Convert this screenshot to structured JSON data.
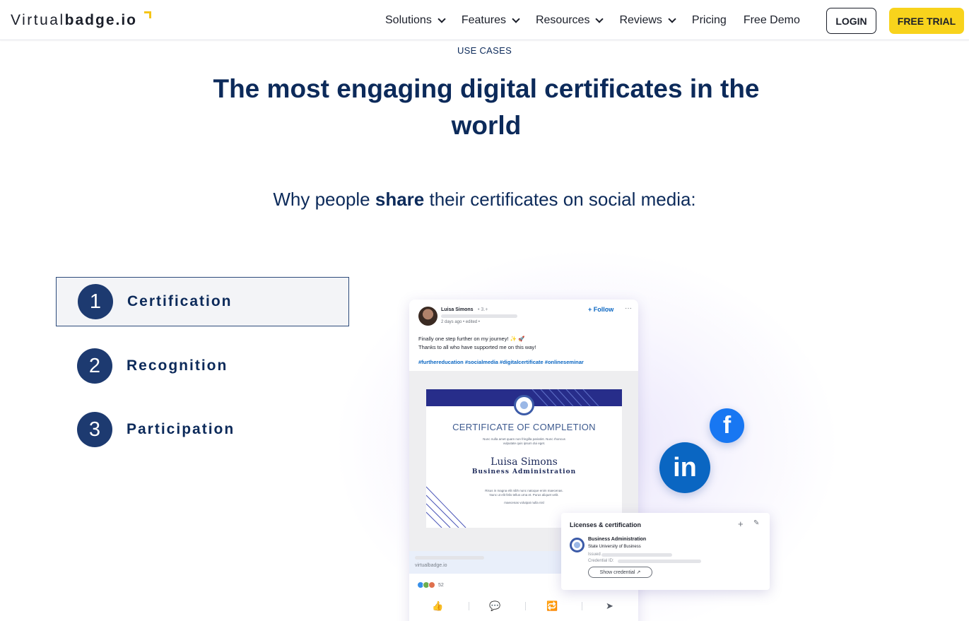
{
  "header": {
    "logo_light": "Virtual",
    "logo_bold": "badge.io",
    "nav": [
      {
        "label": "Solutions",
        "dropdown": true
      },
      {
        "label": "Features",
        "dropdown": true
      },
      {
        "label": "Resources",
        "dropdown": true
      },
      {
        "label": "Reviews",
        "dropdown": true
      },
      {
        "label": "Pricing",
        "dropdown": false
      },
      {
        "label": "Free Demo",
        "dropdown": false
      }
    ],
    "login_label": "LOGIN",
    "trial_label": "FREE TRIAL"
  },
  "hero": {
    "eyebrow": "USE CASES",
    "headline": "The most engaging digital certificates in the world",
    "subline_before": "Why people ",
    "subline_bold": "share",
    "subline_after": " their certificates on social media:"
  },
  "tabs": [
    {
      "number": "1",
      "label": "Certification",
      "active": true
    },
    {
      "number": "2",
      "label": "Recognition",
      "active": false
    },
    {
      "number": "3",
      "label": "Participation",
      "active": false
    }
  ],
  "post": {
    "author": "Luisa Simons",
    "degree": "• 3.+",
    "time": "2 days ago •  edited  •",
    "follow": "+ Follow",
    "more": "···",
    "text_line1": "Finally one step further on my journey! ✨ 🚀",
    "text_line2": "Thanks to all who have supported me on this way!",
    "hashtags": "#furthereducation #socialmedia #digitalcertificate #onlineseminar",
    "link_domain": "virtualbadge.io",
    "reaction_count": "52",
    "certificate": {
      "title": "CERTIFICATE OF COMPLETION",
      "small_top_1": "Nunc nulla amet quam non fringilla pariatint. Nunc rhoncus",
      "small_top_2": "vulputate quis ipsum dui eget.",
      "name": "Luisa Simons",
      "program": "Business Administration",
      "small_bottom_1": "Risus in magna elit nibh nunc natoque enim maecenas.",
      "small_bottom_2": "Nunc ut elit felis tellus urna et. Purus aliquet velit.",
      "small_bottom_3": "maecenas volutpat nulla nisl"
    }
  },
  "licenses": {
    "title": "Licenses & certification",
    "plus": "+",
    "program": "Business Administration",
    "school": "State University of Business",
    "issued_label": "Issued",
    "credential_label": "Credential ID:",
    "show_button": "Show credential"
  },
  "social": {
    "facebook_glyph": "f",
    "linkedin_glyph": "in"
  },
  "colors": {
    "brand_navy": "#0c2a5a",
    "accent_yellow": "#f8d31c",
    "tab_circle": "#1d3a70",
    "linkedin_blue": "#0a66c2",
    "facebook_blue": "#1877f2"
  }
}
